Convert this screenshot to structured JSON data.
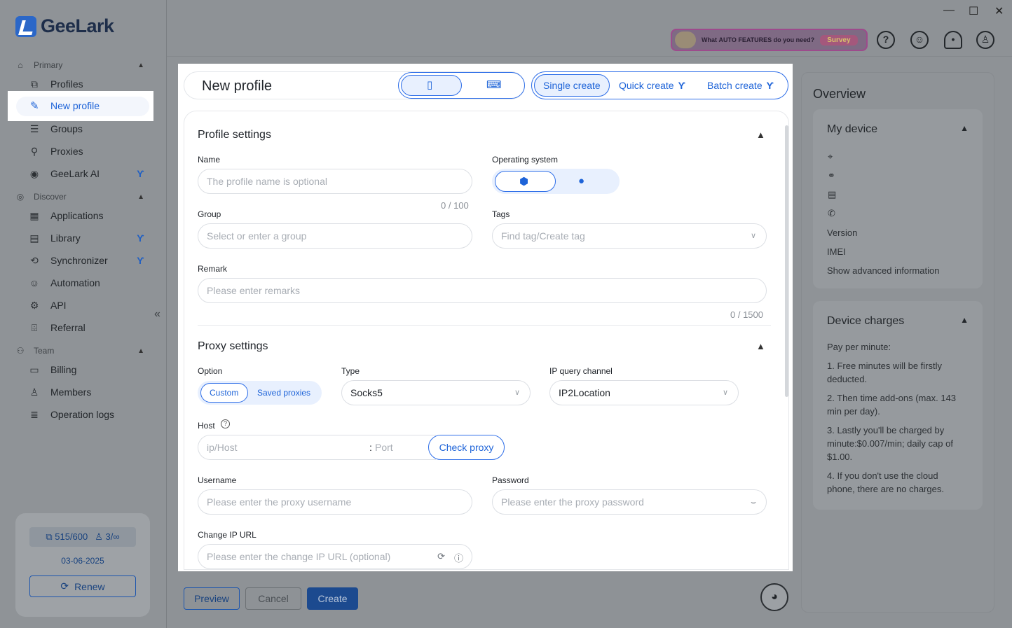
{
  "app": {
    "logo_text": "GeeLark"
  },
  "sidebar": {
    "sections": [
      {
        "label": "Primary",
        "icon": "home-icon"
      },
      {
        "label": "Discover",
        "icon": "compass-icon"
      },
      {
        "label": "Team",
        "icon": "team-icon"
      }
    ],
    "items": [
      {
        "label": "Profiles",
        "icon": "profiles-icon"
      },
      {
        "label": "New profile",
        "icon": "edit-icon"
      },
      {
        "label": "Groups",
        "icon": "list-icon"
      },
      {
        "label": "Proxies",
        "icon": "proxies-icon"
      },
      {
        "label": "GeeLark AI",
        "icon": "ai-icon"
      },
      {
        "label": "Applications",
        "icon": "grid-icon"
      },
      {
        "label": "Library",
        "icon": "library-icon"
      },
      {
        "label": "Synchronizer",
        "icon": "sync-icon"
      },
      {
        "label": "Automation",
        "icon": "robot-icon"
      },
      {
        "label": "API",
        "icon": "api-icon"
      },
      {
        "label": "Referral",
        "icon": "gift-icon"
      },
      {
        "label": "Billing",
        "icon": "billing-icon"
      },
      {
        "label": "Members",
        "icon": "user-icon"
      },
      {
        "label": "Operation logs",
        "icon": "logs-icon"
      }
    ],
    "stats": {
      "devices": "515/600",
      "members": "3/∞"
    },
    "date": "03-06-2025",
    "renew_label": "Renew"
  },
  "topbar": {
    "survey_question_prefix": "What ",
    "survey_question_bold": "AUTO FEATURES",
    "survey_question_suffix": " do you need?",
    "survey_button": "Survey"
  },
  "modal": {
    "title": "New profile",
    "modes": [
      "Single create",
      "Quick create",
      "Batch create"
    ],
    "profile_settings": {
      "heading": "Profile settings",
      "name_label": "Name",
      "name_placeholder": "The profile name is optional",
      "name_counter": "0 / 100",
      "os_label": "Operating system",
      "group_label": "Group",
      "group_placeholder": "Select or enter a group",
      "tags_label": "Tags",
      "tags_placeholder": "Find tag/Create tag",
      "remark_label": "Remark",
      "remark_placeholder": "Please enter remarks",
      "remark_counter": "0 / 1500"
    },
    "proxy_settings": {
      "heading": "Proxy settings",
      "option_label": "Option",
      "options": [
        "Custom",
        "Saved proxies"
      ],
      "type_label": "Type",
      "type_value": "Socks5",
      "ip_channel_label": "IP query channel",
      "ip_channel_value": "IP2Location",
      "host_label": "Host",
      "host_placeholder": "ip/Host",
      "port_placeholder": "Port",
      "port_separator": ":",
      "check_proxy": "Check proxy",
      "username_label": "Username",
      "username_placeholder": "Please enter the proxy username",
      "password_label": "Password",
      "password_placeholder": "Please enter the proxy password",
      "change_ip_label": "Change IP URL",
      "change_ip_placeholder": "Please enter the change IP URL (optional)"
    }
  },
  "footer": {
    "preview": "Preview",
    "cancel": "Cancel",
    "create": "Create"
  },
  "overview": {
    "title": "Overview",
    "my_device": {
      "heading": "My device",
      "version": "Version",
      "imei": "IMEI",
      "advanced": "Show advanced information"
    },
    "device_charges": {
      "heading": "Device charges",
      "subheading": "Pay per minute:",
      "lines": [
        "1. Free minutes will be firstly deducted.",
        "2. Then time add-ons (max. 143 min per day).",
        "3. Lastly you'll be charged by minute:$0.007/min; daily cap of $1.00.",
        "4. If you don't use the cloud phone, there are no charges."
      ]
    }
  },
  "colors": {
    "accent": "#1d63d8",
    "create_button": "#1c4a8f"
  }
}
